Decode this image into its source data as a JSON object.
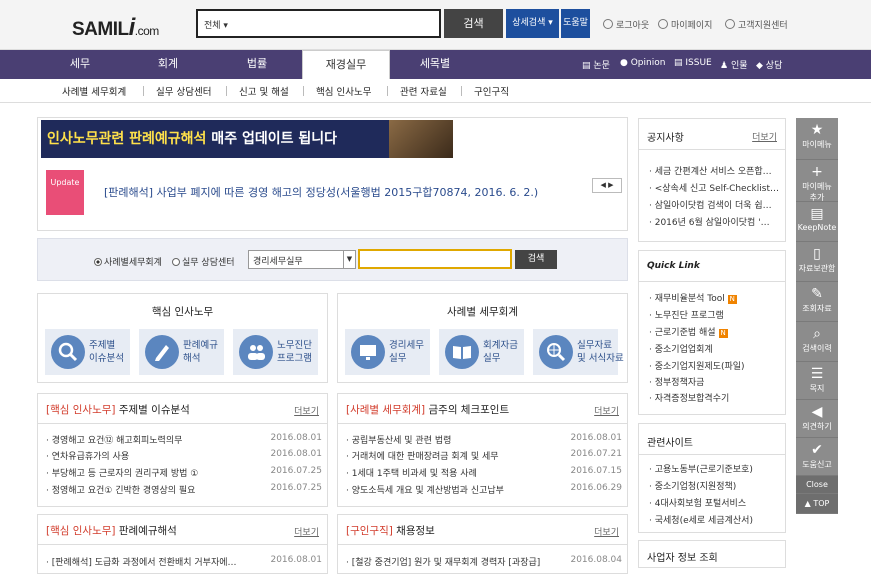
{
  "header": {
    "logo_main": "SAMIL",
    "logo_i": "i",
    "logo_dom": ".com",
    "scope": "전체 ▾",
    "search_btn": "검색",
    "detail_btn": "상세검색 ▾",
    "help_btn": "도움말",
    "logout": "로그아웃",
    "mypage": "마이페이지",
    "support": "고객지원센터"
  },
  "nav": {
    "items": [
      "세무",
      "회계",
      "법률",
      "재경실무",
      "세목별"
    ],
    "right": [
      "논문",
      "Opinion",
      "ISSUE",
      "인물",
      "상담"
    ]
  },
  "subnav": [
    "사례별 세무회계",
    "실무 상담센터",
    "신고 및 해설",
    "핵심 인사노무",
    "관련 자료실",
    "구인구직"
  ],
  "banner": {
    "title_a": "인사노무관련 판례예규해석",
    "title_b": " 매주 업데이트 됩니다",
    "badge": "Update",
    "headline": "[판례해석] 사업부 폐지에 따른 경영 해고의 정당성(서울행법 2015구합70874, 2016. 6. 2.)",
    "arrows": "◀ ▶"
  },
  "search": {
    "radio1": "사례별세무회계",
    "radio2": "실무 상담센터",
    "select": "경리세무실무",
    "btn": "검색"
  },
  "core": {
    "title": "핵심 인사노무",
    "cards": [
      "주제별\n이슈분석",
      "판례예규\n해석",
      "노무진단\n프로그램"
    ]
  },
  "case": {
    "title": "사례별 세무회계",
    "cards": [
      "경리세무\n실무",
      "회계자금\n실무",
      "실무자료\n및 서식자료"
    ]
  },
  "list1": {
    "tag": "[핵심 인사노무]",
    "title": " 주제별 이슈분석",
    "more": "더보기",
    "rows": [
      {
        "t": "경영해고 요건⑫ 해고회피노력의무",
        "d": "2016.08.01"
      },
      {
        "t": "연차유급휴가의 사용",
        "d": "2016.08.01"
      },
      {
        "t": "부당해고 등 근로자의 권리구제 방법 ①",
        "d": "2016.07.25"
      },
      {
        "t": "정영해고 요건① 긴박한 경영상의 필요",
        "d": "2016.07.25"
      }
    ]
  },
  "list2": {
    "tag": "[사례별 세무회계]",
    "title": " 금주의 체크포인트",
    "more": "더보기",
    "rows": [
      {
        "t": "공립부동산세 및 관련 법령",
        "d": "2016.08.01"
      },
      {
        "t": "거래처에 대한 판매장려금 회계 및 세무",
        "d": "2016.07.21"
      },
      {
        "t": "1세대 1주택 비과세 및 적용 사례",
        "d": "2016.07.15"
      },
      {
        "t": "양도소득세 개요 및 계산방법과 신고납부",
        "d": "2016.06.29"
      }
    ]
  },
  "list3": {
    "tag": "[핵심 인사노무]",
    "title": " 판례예규해석",
    "more": "더보기",
    "rows": [
      {
        "t": "[판례해석] 도급화 과정에서 전환배치 거부자에…",
        "d": "2016.08.01"
      }
    ]
  },
  "list4": {
    "tag": "[구인구직]",
    "title": " 채용정보",
    "more": "더보기",
    "rows": [
      {
        "t": "[철강 중견기업] 원가 및 재무회계 경력자 [과장급]",
        "d": "2016.08.04"
      }
    ]
  },
  "notice": {
    "title": "공지사항",
    "more": "더보기",
    "items": [
      "세금 간편계산 서비스 오픈합…",
      "<상속세 신고 Self-Checklist…",
      "삼일아이닷컴 검색이 더욱 쉽…",
      "2016년 6월 삼일아이닷컴 '…"
    ]
  },
  "quick": {
    "title": "Quick Link",
    "items": [
      "재무비율분석 Tool",
      "노무진단 프로그램",
      "근로기준법 해설",
      "중소기업업회계",
      "중소기업지원제도(파일)",
      "정부정책자금",
      "자격증정보합격수기"
    ],
    "badge": "N"
  },
  "sites": {
    "title": "관련사이트",
    "items": [
      "고용노동부(근로기준보호)",
      "중소기업청(지원정책)",
      "4대사회보험 포털서비스",
      "국세청(e세로 세금계산서)"
    ]
  },
  "biz": {
    "title": "사업자 정보 조회"
  },
  "rail": [
    "마이메뉴",
    "마이메뉴\n추가",
    "KeepNote",
    "자료보관함",
    "조회자료",
    "검색이력",
    "목지",
    "의견하기",
    "도움신고",
    "Close",
    "▲ TOP"
  ]
}
